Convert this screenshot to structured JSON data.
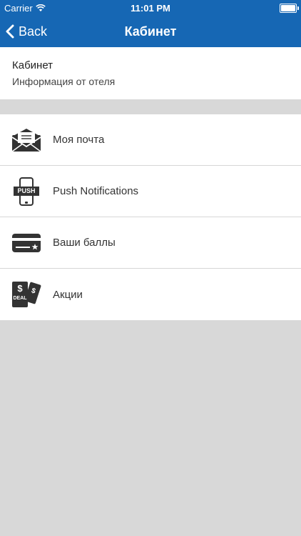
{
  "status_bar": {
    "carrier": "Carrier",
    "time": "11:01 PM"
  },
  "nav": {
    "back_label": "Back",
    "title": "Кабинет"
  },
  "header": {
    "title": "Кабинет",
    "subtitle": "Информация от отеля"
  },
  "menu": {
    "items": [
      {
        "label": "Моя почта",
        "icon": "mail-icon"
      },
      {
        "label": "Push Notifications",
        "icon": "push-phone-icon",
        "icon_text": "PUSH"
      },
      {
        "label": "Ваши баллы",
        "icon": "points-card-icon"
      },
      {
        "label": "Акции",
        "icon": "deal-tickets-icon",
        "icon_text": "DEAL"
      }
    ]
  },
  "colors": {
    "nav_background": "#1667b4",
    "page_background": "#d8d8d8",
    "icon": "#333333"
  }
}
